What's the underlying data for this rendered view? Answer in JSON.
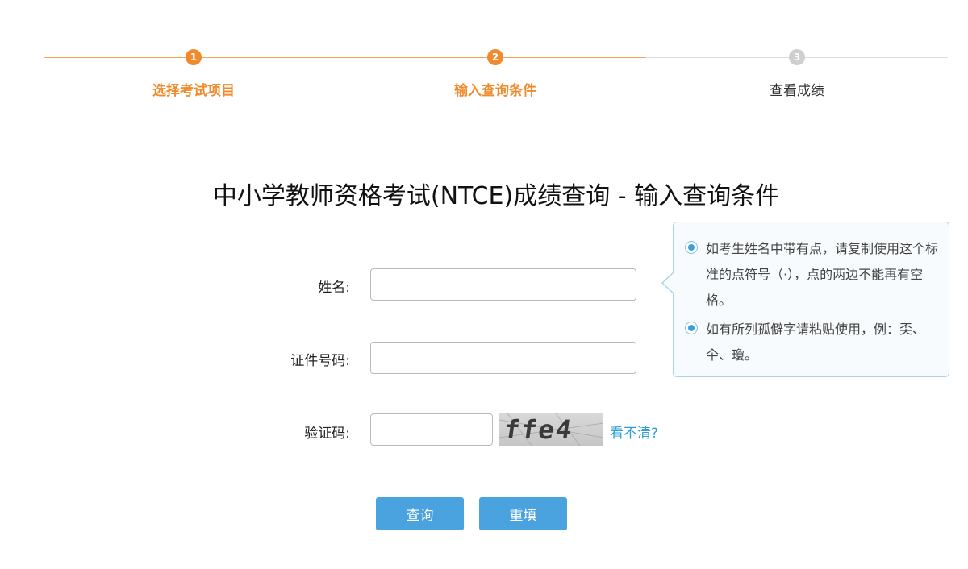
{
  "stepper": {
    "steps": [
      {
        "number": "1",
        "label": "选择考试项目",
        "state": "done"
      },
      {
        "number": "2",
        "label": "输入查询条件",
        "state": "current"
      },
      {
        "number": "3",
        "label": "查看成绩",
        "state": "pending"
      }
    ]
  },
  "page_title": "中小学教师资格考试(NTCE)成绩查询 - 输入查询条件",
  "form": {
    "name_label": "姓名:",
    "name_value": "",
    "id_label": "证件号码:",
    "id_value": "",
    "captcha_label": "验证码:",
    "captcha_value": "",
    "captcha_image_text": "ffe4",
    "captcha_refresh": "看不清?"
  },
  "tip": {
    "items": [
      "如考生姓名中带有点，请复制使用这个标准的点符号（·），点的两边不能再有空格。",
      "如有所列孤僻字请粘贴使用，例：奀、仐、瓊。"
    ]
  },
  "buttons": {
    "query": "查询",
    "reset": "重填"
  },
  "colors": {
    "accent_orange": "#ef8b2c",
    "button_blue": "#4aa3df",
    "link_blue": "#2d9fd8"
  }
}
